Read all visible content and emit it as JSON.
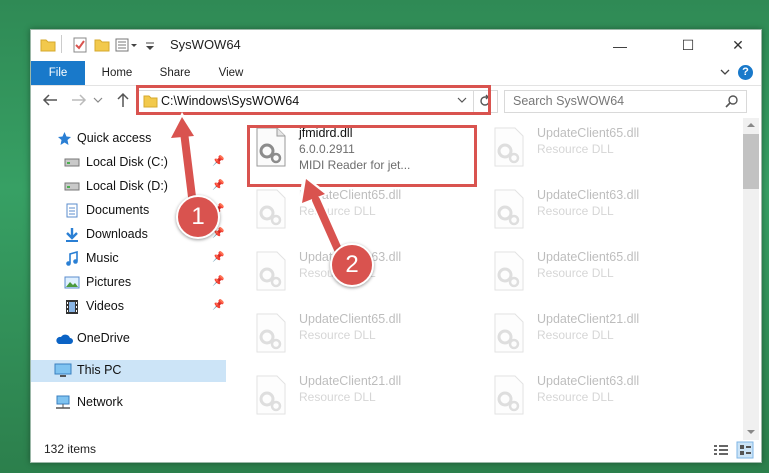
{
  "window": {
    "title": "SysWOW64",
    "minimize_glyph": "—",
    "maximize_glyph": "☐",
    "close_glyph": "✕"
  },
  "ribbon": {
    "tabs": [
      "File",
      "Home",
      "Share",
      "View"
    ],
    "help_glyph": "?"
  },
  "nav": {
    "address": "C:\\Windows\\SysWOW64",
    "search_placeholder": "Search SysWOW64"
  },
  "sidebar": {
    "items": [
      {
        "label": "Quick access",
        "icon": "star-icon"
      },
      {
        "label": "Local Disk (C:)",
        "icon": "drive-icon"
      },
      {
        "label": "Local Disk (D:)",
        "icon": "drive-icon"
      },
      {
        "label": "Documents",
        "icon": "documents-icon"
      },
      {
        "label": "Downloads",
        "icon": "download-icon"
      },
      {
        "label": "Music",
        "icon": "music-icon"
      },
      {
        "label": "Pictures",
        "icon": "pictures-icon"
      },
      {
        "label": "Videos",
        "icon": "videos-icon"
      },
      {
        "label": "OneDrive",
        "icon": "cloud-icon"
      },
      {
        "label": "This PC",
        "icon": "computer-icon"
      },
      {
        "label": "Network",
        "icon": "network-icon"
      }
    ]
  },
  "files": [
    {
      "name": "jfmidrd.dll",
      "line2": "6.0.0.2911",
      "line3": "MIDI Reader for jet..."
    },
    {
      "name": "UpdateClient65.dll",
      "line2": "Resource DLL"
    },
    {
      "name": "UpdateClient65.dll",
      "line2": "Resource DLL"
    },
    {
      "name": "UpdateClient63.dll",
      "line2": "Resource DLL"
    },
    {
      "name": "UpdateClient63.dll",
      "line2": "Resource DLL"
    },
    {
      "name": "UpdateClient65.dll",
      "line2": "Resource DLL"
    },
    {
      "name": "UpdateClient65.dll",
      "line2": "Resource DLL"
    },
    {
      "name": "UpdateClient21.dll",
      "line2": "Resource DLL"
    },
    {
      "name": "UpdateClient21.dll",
      "line2": "Resource DLL"
    },
    {
      "name": "UpdateClient63.dll",
      "line2": "Resource DLL"
    }
  ],
  "status": {
    "items": "132 items"
  },
  "annotations": {
    "badge1": "1",
    "badge2": "2"
  },
  "colors": {
    "accent": "#1979ca",
    "highlight": "#d9534f",
    "selection": "#cce4f7"
  }
}
